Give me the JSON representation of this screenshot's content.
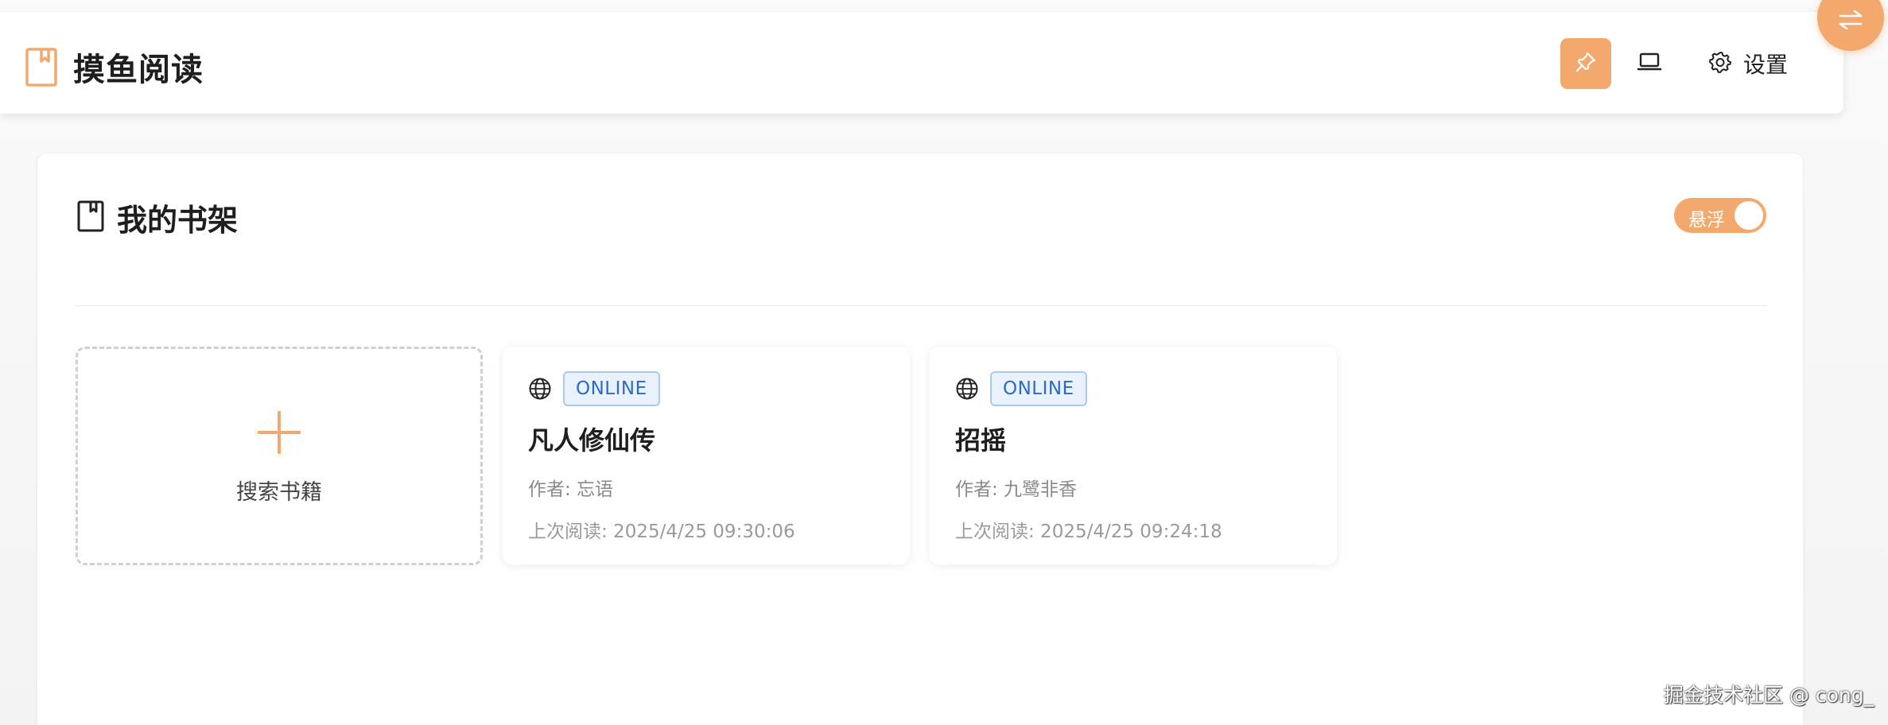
{
  "header": {
    "app_title": "摸鱼阅读",
    "brand_icon": "bookmark-icon",
    "pin_icon": "pin-icon",
    "laptop_icon": "laptop-icon",
    "settings_icon": "gear-icon",
    "settings_label": "设置",
    "float_icon": "swap-arrows-icon",
    "accent_color": "#f3a96d"
  },
  "shelf": {
    "title": "我的书架",
    "title_icon": "bookmark-outline-icon",
    "float_toggle_label": "悬浮",
    "float_toggle_on": true,
    "add_label": "搜索书籍",
    "books": [
      {
        "source_icon": "globe-icon",
        "badge": "ONLINE",
        "title": "凡人修仙传",
        "author": "作者: 忘语",
        "last_read": "上次阅读: 2025/4/25 09:30:06"
      },
      {
        "source_icon": "globe-icon",
        "badge": "ONLINE",
        "title": "招摇",
        "author": "作者: 九鹭非香",
        "last_read": "上次阅读: 2025/4/25 09:24:18"
      }
    ]
  },
  "watermark": "掘金技术社区 @ cong_"
}
